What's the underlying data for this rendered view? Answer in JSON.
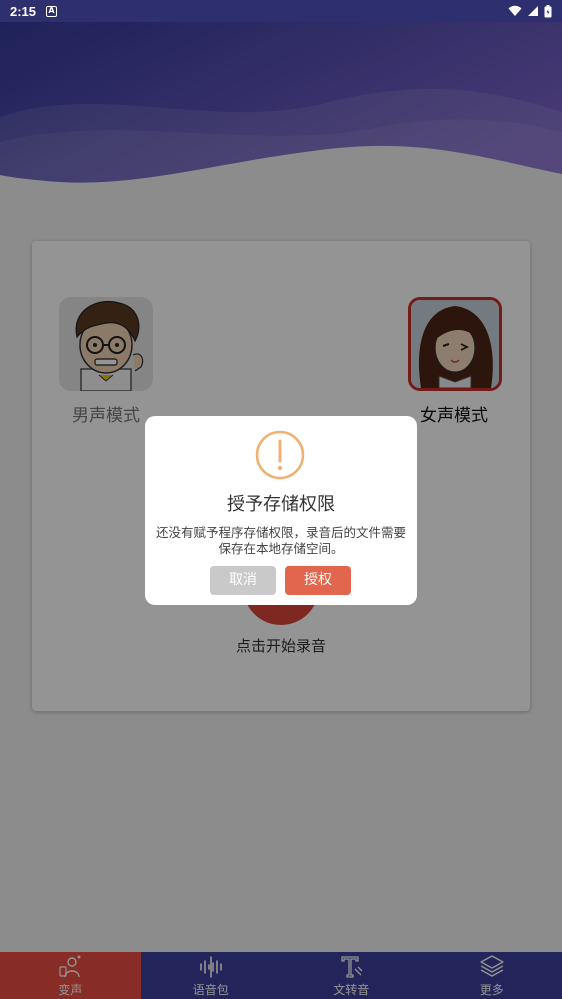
{
  "status_bar": {
    "time": "2:15",
    "notif_letter": "A"
  },
  "card": {
    "male_label": "男声模式",
    "female_label": "女声模式",
    "record_label": "点击开始录音"
  },
  "dialog": {
    "title": "授予存储权限",
    "message": "还没有赋予程序存储权限，录音后的文件需要保存在本地存储空间。",
    "cancel_label": "取消",
    "grant_label": "授权"
  },
  "nav": {
    "items": [
      {
        "label": "变声",
        "icon": "voice-change-icon",
        "active": true
      },
      {
        "label": "语音包",
        "icon": "waveform-icon",
        "active": false
      },
      {
        "label": "文转音",
        "icon": "text-to-speech-icon",
        "active": false
      },
      {
        "label": "更多",
        "icon": "layers-icon",
        "active": false
      }
    ]
  },
  "colors": {
    "header_primary": "#3b3f9c",
    "header_secondary": "#8a6fd0",
    "accent_red": "#e84c43",
    "warning_orange": "#f0b070",
    "grant_button": "#e2664d"
  }
}
